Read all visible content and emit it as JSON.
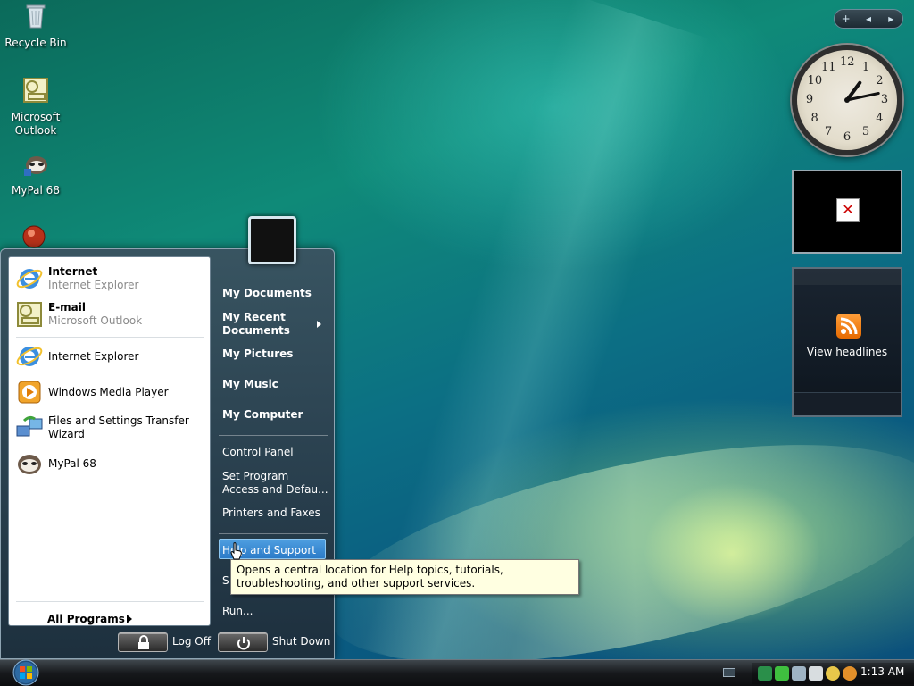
{
  "desktop": {
    "icons": [
      {
        "label": "Recycle Bin"
      },
      {
        "label": "Microsoft Outlook"
      },
      {
        "label": "MyPal 68"
      }
    ]
  },
  "gadgets": {
    "toolbar": {
      "add": "+",
      "prev": "◂",
      "next": "▸"
    },
    "clock": {
      "numbers": [
        "12",
        "1",
        "2",
        "3",
        "4",
        "5",
        "6",
        "7",
        "8",
        "9",
        "10",
        "11"
      ],
      "hour": 1,
      "minute": 13
    },
    "slideshow": {
      "broken_image": "✕"
    },
    "feed": {
      "label": "View headlines"
    }
  },
  "start_menu": {
    "pinned": [
      {
        "title": "Internet",
        "subtitle": "Internet Explorer",
        "icon": "ie-icon"
      },
      {
        "title": "E-mail",
        "subtitle": "Microsoft Outlook",
        "icon": "outlook-icon"
      }
    ],
    "recent": [
      {
        "title": "Internet Explorer",
        "icon": "ie-icon"
      },
      {
        "title": "Windows Media Player",
        "icon": "media-player-icon"
      },
      {
        "title": "Files and Settings Transfer Wizard",
        "icon": "transfer-wizard-icon"
      },
      {
        "title": "MyPal 68",
        "icon": "mypal-icon"
      }
    ],
    "all_programs": "All Programs",
    "right": {
      "my_documents": "My Documents",
      "my_recent_documents_1": "My Recent",
      "my_recent_documents_2": "Documents",
      "my_pictures": "My Pictures",
      "my_music": "My Music",
      "my_computer": "My Computer",
      "control_panel": "Control Panel",
      "set_program_1": "Set Program",
      "set_program_2": "Access and Defau...",
      "printers": "Printers and Faxes",
      "help": "Help and Support",
      "search_partial": "S",
      "run": "Run..."
    },
    "log_off": "Log Off",
    "shut_down": "Shut Down",
    "tooltip": "Opens a central location for Help topics, tutorials, troubleshooting, and other support services."
  },
  "taskbar": {
    "time": "1:13 AM"
  }
}
